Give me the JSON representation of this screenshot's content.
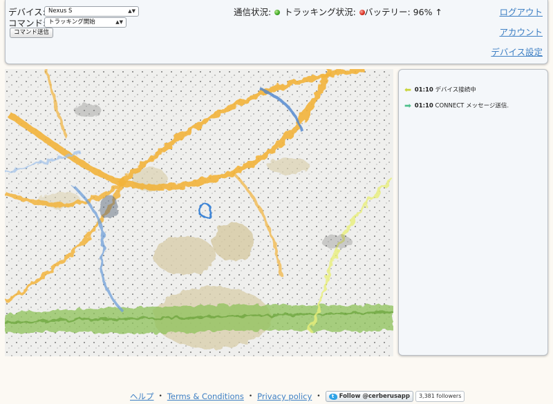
{
  "header": {
    "device_label": "デバイス:",
    "device_value": "Nexus S",
    "command_label": "コマンド:",
    "command_value": "トラッキング開始",
    "send_button": "コマンド送信",
    "comm_status_label": "通信状況:",
    "comm_status_color": "#3aa322",
    "tracking_status_label": "トラッキング状況:",
    "tracking_status_color": "#d92b1c",
    "battery_label": "バッテリー: 96%",
    "battery_arrow": "↑",
    "links": {
      "logout": "ログアウト",
      "account": "アカウント",
      "device_settings": "デバイス設定"
    }
  },
  "log": [
    {
      "icon": "arrow-left-icon",
      "time": "01:10",
      "message": "デバイス接続中"
    },
    {
      "icon": "arrow-right-icon",
      "time": "01:10",
      "message": "CONNECT メッセージ送信."
    }
  ],
  "footer": {
    "help": "ヘルプ",
    "separator": "•",
    "terms": "Terms & Conditions",
    "privacy": "Privacy policy",
    "twitter_follow": "Follow @cerberusapp",
    "followers": "3,381 followers"
  }
}
